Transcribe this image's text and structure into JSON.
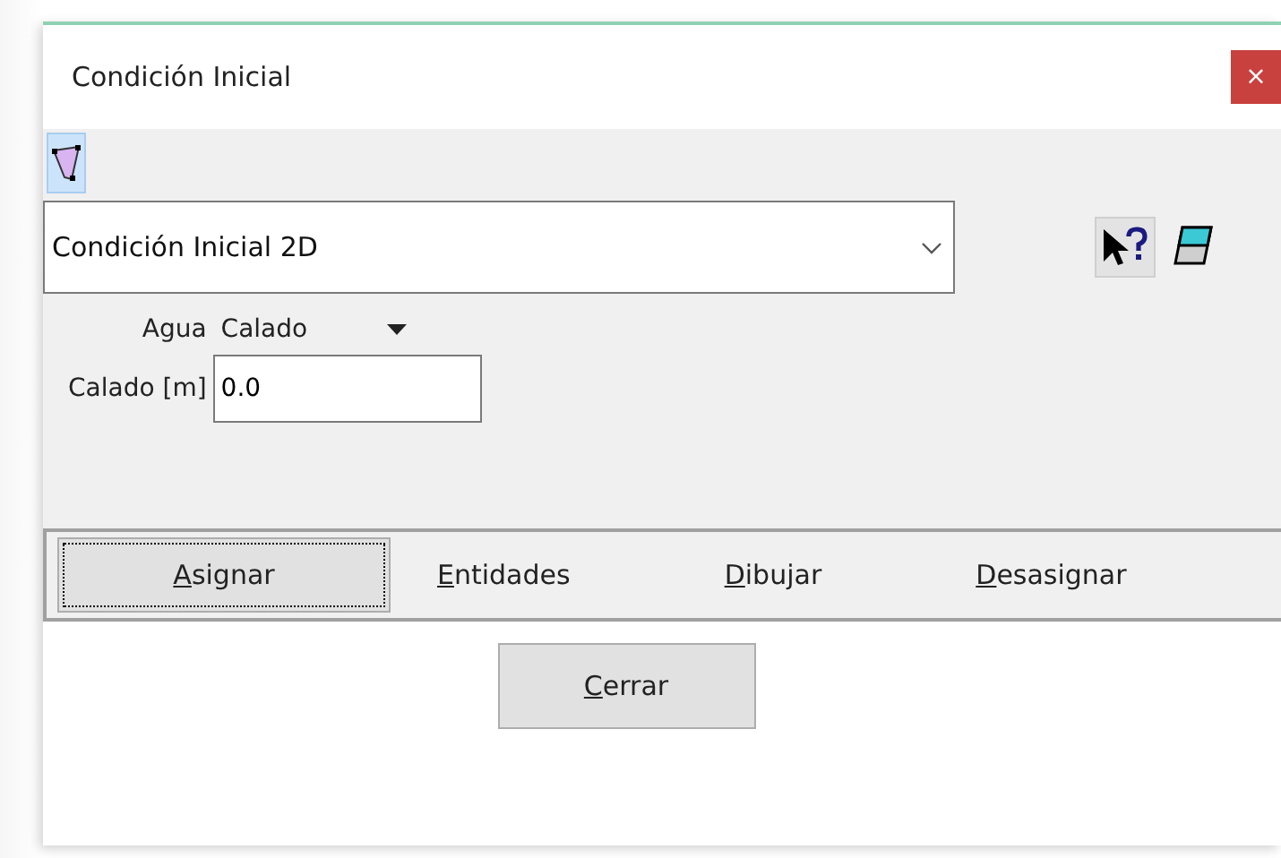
{
  "window": {
    "title": "Condición Inicial",
    "close": "×"
  },
  "toolbar": [
    {
      "kind": "polygon",
      "selected": true
    }
  ],
  "condition_select": {
    "value": "Condición Inicial 2D"
  },
  "side_icons": [
    {
      "kind": "help"
    },
    {
      "kind": "eraser"
    }
  ],
  "water": {
    "label": "Agua",
    "value": "Calado"
  },
  "depth": {
    "label": "Calado [m]",
    "value": "0.0"
  },
  "actions": [
    {
      "label": "Asignar",
      "focused": true
    },
    {
      "label": "Entidades",
      "focused": false
    },
    {
      "label": "Dibujar",
      "focused": false
    },
    {
      "label": "Desasignar",
      "focused": false
    }
  ],
  "close_button": {
    "label": "Cerrar"
  }
}
